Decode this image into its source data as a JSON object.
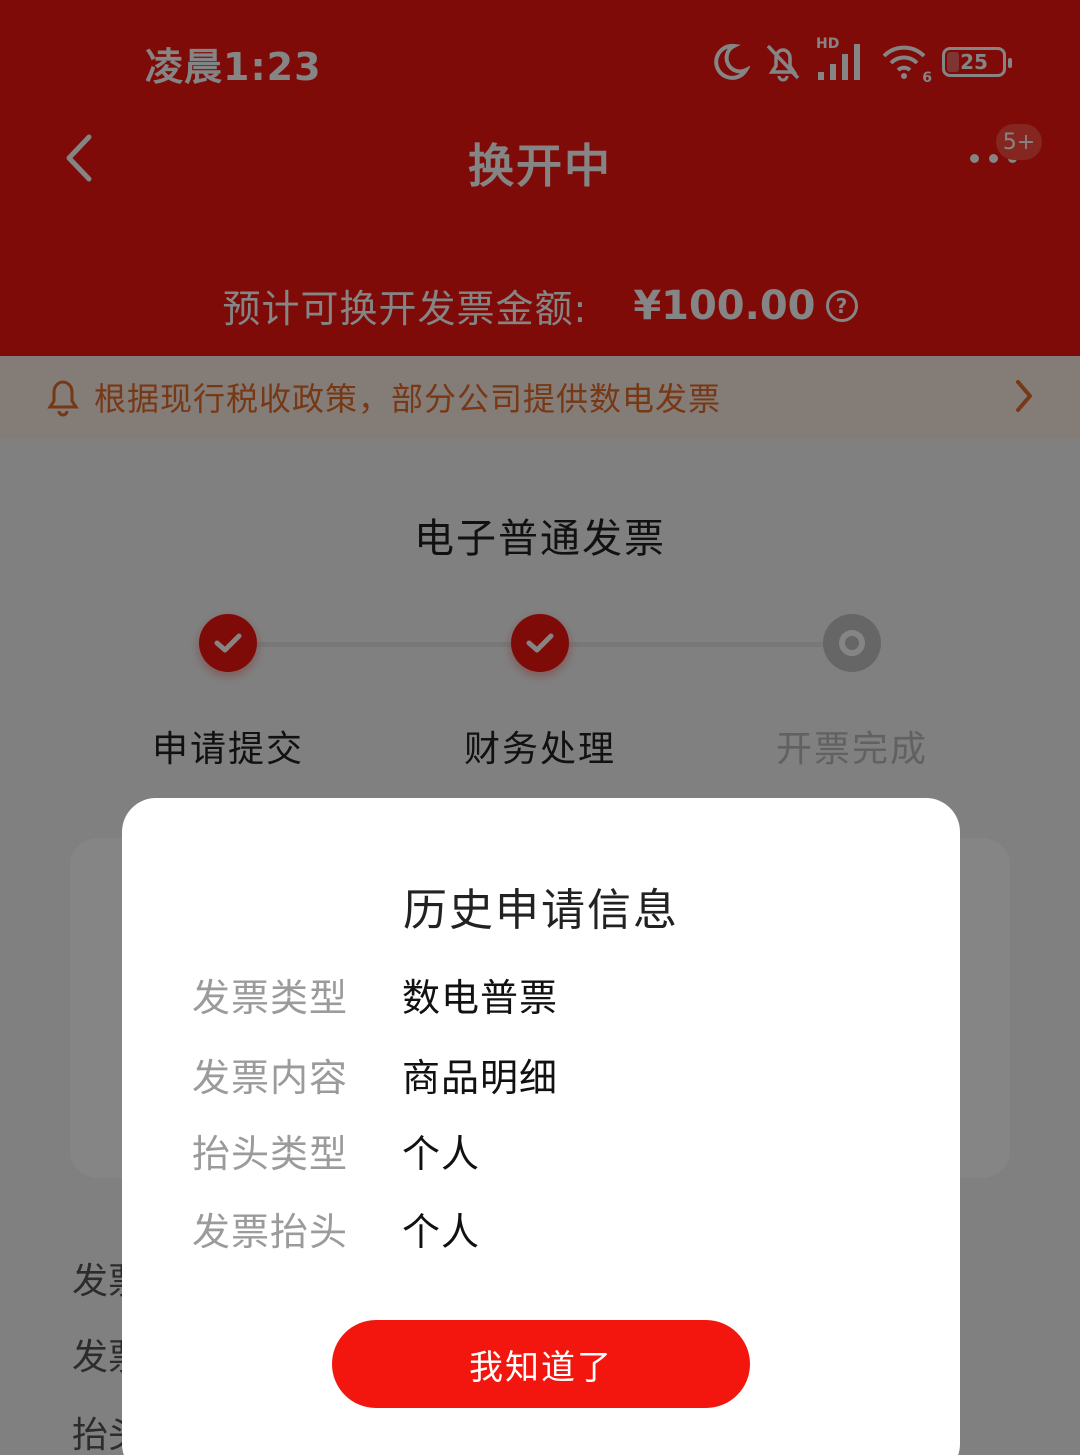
{
  "status_bar": {
    "time": "凌晨1:23",
    "network_label": "HD",
    "wifi_sub": "6",
    "battery": "25"
  },
  "nav": {
    "title": "换开中",
    "badge": "5+"
  },
  "amount": {
    "label": "预计可换开发票金额:",
    "value": "¥100.00",
    "help": "?"
  },
  "notice": {
    "text": "根据现行税收政策，部分公司提供数电发票"
  },
  "invoice": {
    "type": "电子普通发票"
  },
  "steps": [
    {
      "label": "申请提交",
      "status": "done"
    },
    {
      "label": "财务处理",
      "status": "done"
    },
    {
      "label": "开票完成",
      "status": "pending"
    }
  ],
  "background_labels": [
    "发票",
    "发票",
    "抬头"
  ],
  "modal": {
    "title": "历史申请信息",
    "rows": [
      {
        "key": "发票类型",
        "value": "数电普票"
      },
      {
        "key": "发票内容",
        "value": "商品明细"
      },
      {
        "key": "抬头类型",
        "value": "个人"
      },
      {
        "key": "发票抬头",
        "value": "个人"
      }
    ],
    "button": "我知道了"
  },
  "colors": {
    "brand_red": "#f2160f",
    "notice_text": "#e46b2b",
    "notice_bg": "#fdeee4"
  },
  "icons": [
    "moon-icon",
    "bell-muted-icon",
    "signal-icon",
    "wifi-icon",
    "battery-icon",
    "back-arrow-icon",
    "more-icon",
    "help-icon",
    "bell-icon",
    "chevron-right-icon",
    "check-icon"
  ]
}
